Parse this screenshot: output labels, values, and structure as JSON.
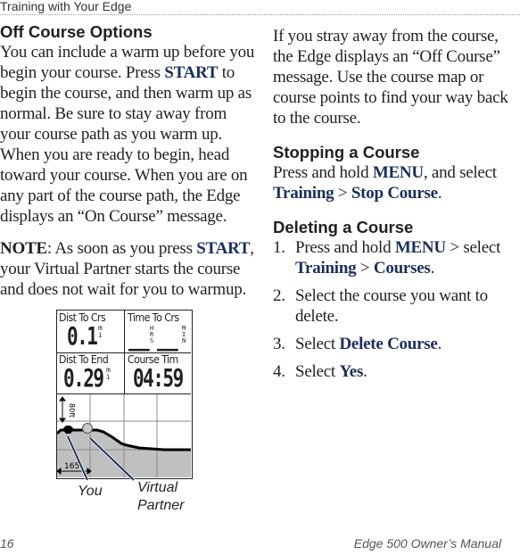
{
  "header": {
    "title": "Training with Your Edge"
  },
  "left": {
    "section_title": "Off Course Options",
    "intro": {
      "p1": "You can include a warm up before you begin your course. Press ",
      "kw1": "START",
      "p2": " to begin the course, and then warm up as normal. Be sure to stay away from your course path as you warm up. When you are ready to begin, head toward your course. When you are on any part of the course path, the Edge displays an “On Course” message."
    },
    "note": {
      "label": "NOTE",
      "p1": ": As soon as you press ",
      "kw1": "START",
      "p2": ", your Virtual Partner starts the course and does not wait for you to warmup."
    }
  },
  "device": {
    "fields": [
      {
        "label": "Dist To Crs",
        "value": "0.1",
        "unit": "mi"
      },
      {
        "label": "Time To Crs",
        "value_hrs": "__",
        "unit_hrs": "HRS",
        "value_min": "__",
        "unit_min": "MIN"
      },
      {
        "label": "Dist To End",
        "value": "0.29",
        "unit": "mi"
      },
      {
        "label": "Course Tim",
        "value": "04:59"
      }
    ],
    "elevation": {
      "vertical_scale": "80ft",
      "horizontal_scale": "165'"
    },
    "callouts": {
      "you": "You",
      "virtual_partner_1": "Virtual",
      "virtual_partner_2": "Partner"
    },
    "icons": [
      "you-marker-icon",
      "virtual-partner-marker-icon"
    ]
  },
  "right": {
    "off_course": "If you stray away from the course, the Edge displays an “Off Course” message. Use the course map or course points to find your way back to the course.",
    "stopping": {
      "title": "Stopping a Course",
      "p1": "Press and hold ",
      "kw1": "MENU",
      "p2": ", and select ",
      "kw2": "Training",
      "sep": " > ",
      "kw3": "Stop Course",
      "end": "."
    },
    "deleting": {
      "title": "Deleting a Course",
      "steps": [
        {
          "num": "1.",
          "t1": "Press and hold ",
          "k1": "MENU",
          "t2": " > select ",
          "k2": "Training",
          "t3": " > ",
          "k3": "Courses",
          "t4": "."
        },
        {
          "num": "2.",
          "t1": "Select the course you want to delete."
        },
        {
          "num": "3.",
          "t1": "Select ",
          "k1": "Delete Course",
          "t2": "."
        },
        {
          "num": "4.",
          "t1": "Select ",
          "k1": "Yes",
          "t2": "."
        }
      ]
    }
  },
  "footer": {
    "page_number": "16",
    "manual_title": "Edge 500 Owner’s Manual"
  },
  "colors": {
    "keyword": "#1a2f5e",
    "text": "#231f20",
    "terrain": "#c0c0c0"
  }
}
